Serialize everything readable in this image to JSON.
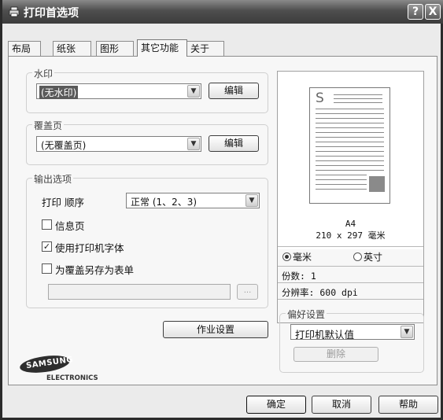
{
  "window": {
    "title": "打印首选项",
    "help_button": "?",
    "close_button": "X"
  },
  "tabs": [
    {
      "label": "布局",
      "active": false
    },
    {
      "label": "纸张",
      "active": false
    },
    {
      "label": "图形",
      "active": false
    },
    {
      "label": "其它功能",
      "active": true
    },
    {
      "label": "关于",
      "active": false
    }
  ],
  "watermark": {
    "group_title": "水印",
    "selected": "(无水印)",
    "edit_button": "编辑"
  },
  "overlay": {
    "group_title": "覆盖页",
    "selected": "(无覆盖页)",
    "edit_button": "编辑"
  },
  "output_options": {
    "group_title": "输出选项",
    "print_order_label": "打印 顺序",
    "print_order_value": "正常 (1、2、3)",
    "checkboxes": [
      {
        "label": "信息页",
        "checked": false
      },
      {
        "label": "使用打印机字体",
        "checked": true
      },
      {
        "label": "为覆盖另存为表单",
        "checked": false
      }
    ],
    "path_value": "",
    "browse_button": "..."
  },
  "job_settings_button": "作业设置",
  "preview": {
    "paper_letter": "S",
    "paper_name": "A4",
    "paper_dims": "210 x 297 毫米",
    "units": [
      {
        "label": "毫米",
        "selected": true
      },
      {
        "label": "英寸",
        "selected": false
      }
    ],
    "copies": "份数: 1",
    "resolution": "分辨率: 600 dpi"
  },
  "favorites": {
    "group_title": "偏好设置",
    "selected": "打印机默认值",
    "delete_button": "删除"
  },
  "logo": {
    "brand": "SAMSUNG",
    "sub": "ELECTRONICS"
  },
  "footer": {
    "ok": "确定",
    "cancel": "取消",
    "help": "帮助"
  }
}
